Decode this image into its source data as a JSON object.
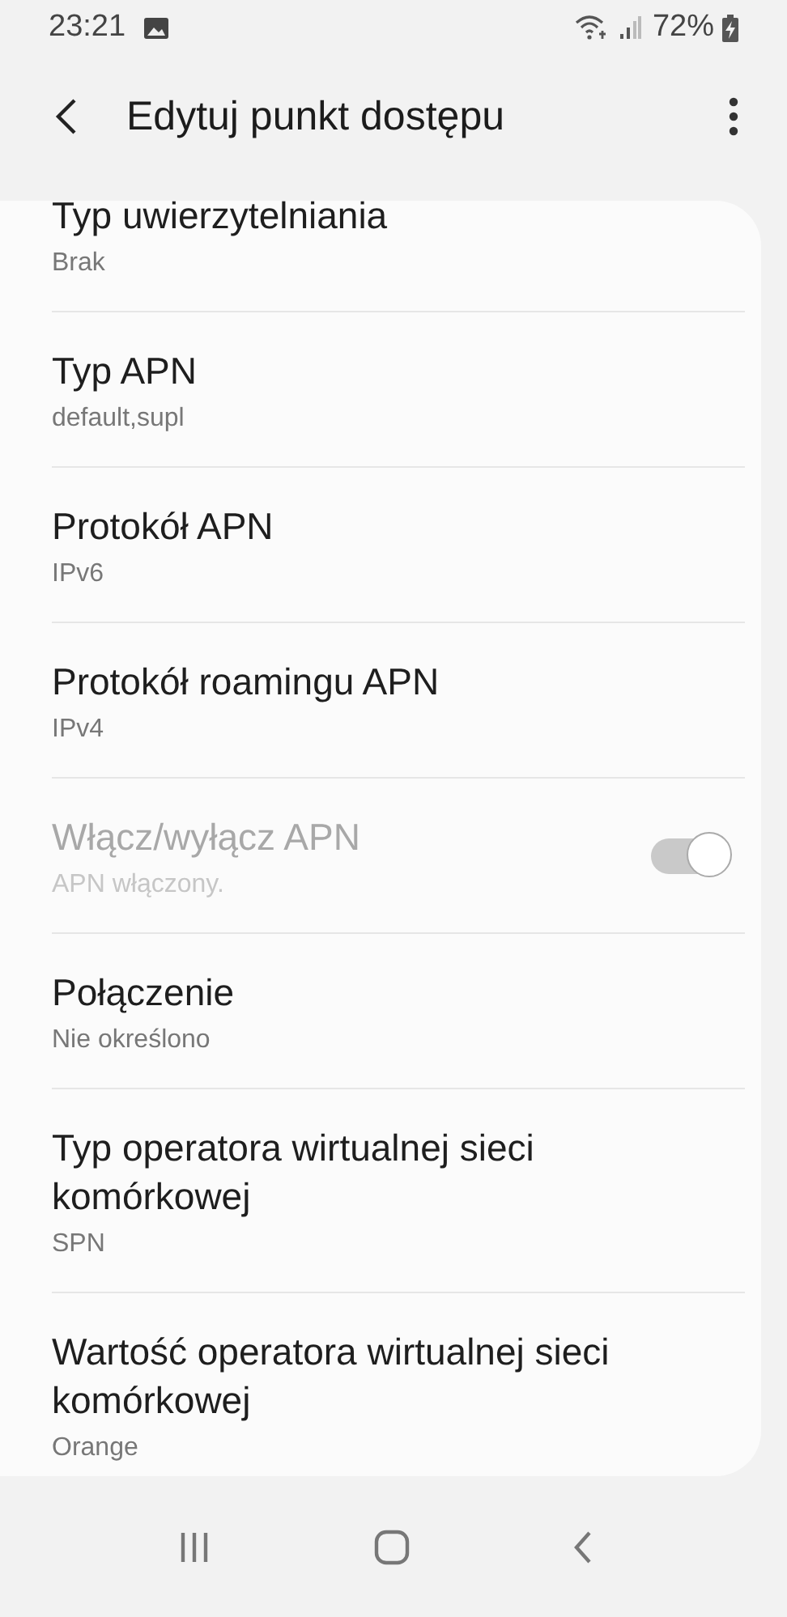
{
  "status_bar": {
    "time": "23:21",
    "battery": "72%"
  },
  "header": {
    "title": "Edytuj punkt dostępu"
  },
  "items": [
    {
      "kind": "text",
      "title": "Typ uwierzytelniania",
      "value": "Brak",
      "disabled": false
    },
    {
      "kind": "text",
      "title": "Typ APN",
      "value": "default,supl",
      "disabled": false
    },
    {
      "kind": "text",
      "title": "Protokół APN",
      "value": "IPv6",
      "disabled": false
    },
    {
      "kind": "text",
      "title": "Protokół roamingu APN",
      "value": "IPv4",
      "disabled": false
    },
    {
      "kind": "switch",
      "title": "Włącz/wyłącz APN",
      "value": "APN włączony.",
      "disabled": true,
      "on": true
    },
    {
      "kind": "text",
      "title": "Połączenie",
      "value": "Nie określono",
      "disabled": false
    },
    {
      "kind": "text",
      "title": "Typ operatora wirtualnej sieci komórkowej",
      "value": "SPN",
      "disabled": false
    },
    {
      "kind": "text",
      "title": "Wartość operatora wirtualnej sieci komórkowej",
      "value": "Orange",
      "disabled": false
    }
  ]
}
